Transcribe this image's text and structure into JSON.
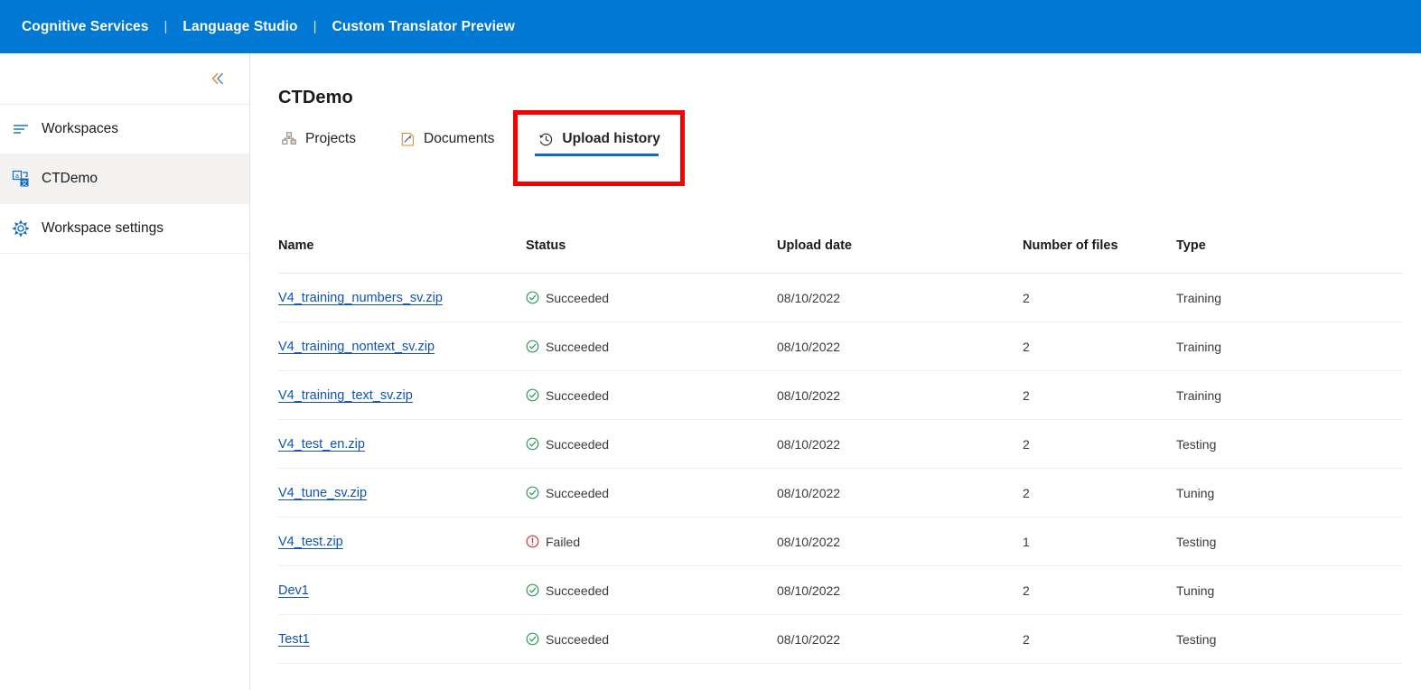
{
  "header": {
    "links": [
      {
        "label": "Cognitive Services"
      },
      {
        "label": "Language Studio"
      },
      {
        "label": "Custom Translator Preview"
      }
    ],
    "separator": "|",
    "background_color": "#0078d4"
  },
  "sidebar": {
    "collapse_icon": "chevron-double-left-icon",
    "items": [
      {
        "label": "Workspaces",
        "icon": "list-icon",
        "selected": false
      },
      {
        "label": "CTDemo",
        "icon": "translate-icon",
        "selected": true
      },
      {
        "label": "Workspace settings",
        "icon": "gear-icon",
        "selected": false
      }
    ]
  },
  "main": {
    "page_title": "CTDemo",
    "tabs": [
      {
        "label": "Projects",
        "icon": "projects-icon",
        "active": false
      },
      {
        "label": "Documents",
        "icon": "documents-icon",
        "active": false
      },
      {
        "label": "Upload history",
        "icon": "history-icon",
        "active": true
      }
    ],
    "active_tab_underline_color": "#0f6cbd",
    "highlight_box_color": "#f40000",
    "table": {
      "columns": [
        "Name",
        "Status",
        "Upload date",
        "Number of files",
        "Type"
      ],
      "rows": [
        {
          "name": "V4_training_numbers_sv.zip",
          "status": "Succeeded",
          "status_icon": "check-circle-icon",
          "date": "08/10/2022",
          "files": "2",
          "type": "Training"
        },
        {
          "name": "V4_training_nontext_sv.zip",
          "status": "Succeeded",
          "status_icon": "check-circle-icon",
          "date": "08/10/2022",
          "files": "2",
          "type": "Training"
        },
        {
          "name": "V4_training_text_sv.zip",
          "status": "Succeeded",
          "status_icon": "check-circle-icon",
          "date": "08/10/2022",
          "files": "2",
          "type": "Training"
        },
        {
          "name": "V4_test_en.zip",
          "status": "Succeeded",
          "status_icon": "check-circle-icon",
          "date": "08/10/2022",
          "files": "2",
          "type": "Testing"
        },
        {
          "name": "V4_tune_sv.zip",
          "status": "Succeeded",
          "status_icon": "check-circle-icon",
          "date": "08/10/2022",
          "files": "2",
          "type": "Tuning"
        },
        {
          "name": "V4_test.zip",
          "status": "Failed",
          "status_icon": "error-circle-icon",
          "date": "08/10/2022",
          "files": "1",
          "type": "Testing"
        },
        {
          "name": "Dev1",
          "status": "Succeeded",
          "status_icon": "check-circle-icon",
          "date": "08/10/2022",
          "files": "2",
          "type": "Tuning"
        },
        {
          "name": "Test1",
          "status": "Succeeded",
          "status_icon": "check-circle-icon",
          "date": "08/10/2022",
          "files": "2",
          "type": "Testing"
        }
      ],
      "status_success_color": "#2e9b57",
      "status_failed_color": "#d13438",
      "link_color": "#0f52b4"
    }
  }
}
